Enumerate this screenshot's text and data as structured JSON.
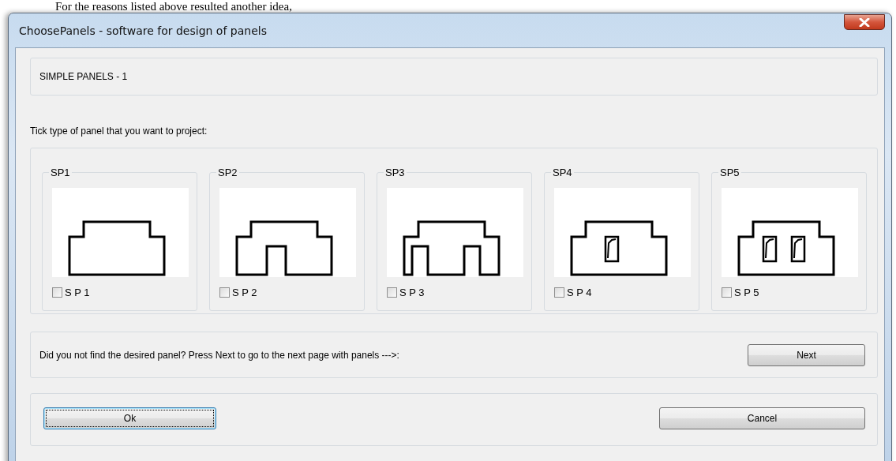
{
  "document_text": "For the reasons listed above resulted another idea,",
  "window": {
    "title": "ChoosePanels - software for design of panels"
  },
  "header": {
    "label": "SIMPLE PANELS - 1"
  },
  "instruction": "Tick type of panel that you want to project:",
  "panels": [
    {
      "title": "SP1",
      "kind": "plain",
      "checkbox_label": "S P 1",
      "checked": false
    },
    {
      "title": "SP2",
      "kind": "one-notch",
      "checkbox_label": "S P 2",
      "checked": false
    },
    {
      "title": "SP3",
      "kind": "two-notch",
      "checkbox_label": "S P 3",
      "checked": false
    },
    {
      "title": "SP4",
      "kind": "one-window",
      "checkbox_label": "S P 4",
      "checked": false
    },
    {
      "title": "SP5",
      "kind": "two-window",
      "checkbox_label": "S P 5",
      "checked": false
    }
  ],
  "next_prompt": "Did you not find the desired panel? Press Next to go to the next page with panels --->:",
  "next_button": "Next",
  "ok_button": {
    "label": "Ok",
    "focused": true
  },
  "cancel_button": "Cancel"
}
